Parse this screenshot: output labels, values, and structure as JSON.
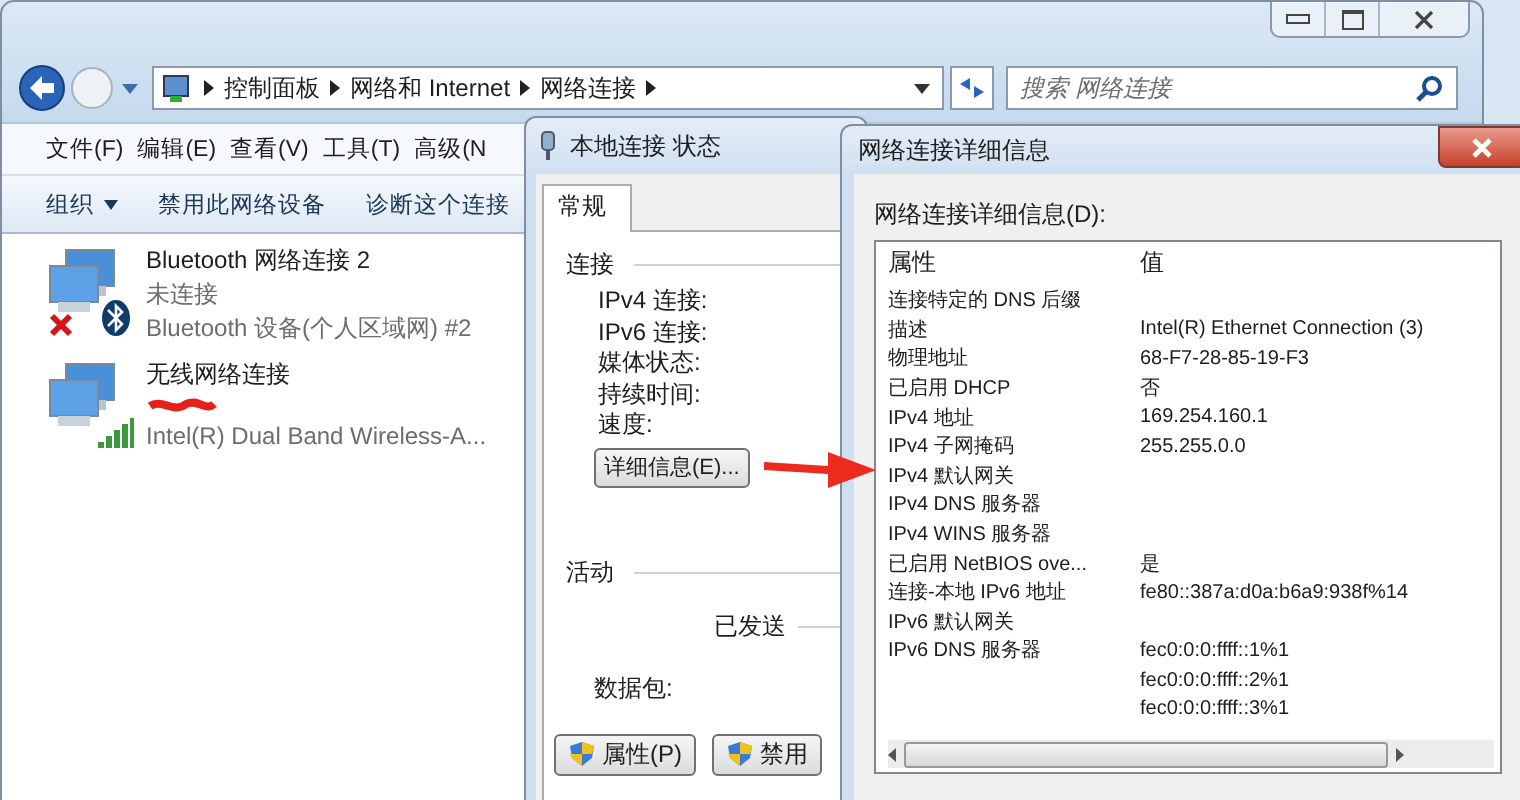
{
  "explorer": {
    "breadcrumb": [
      "控制面板",
      "网络和 Internet",
      "网络连接"
    ],
    "search": {
      "placeholder": "搜索 网络连接"
    },
    "menu": [
      "文件(F)",
      "编辑(E)",
      "查看(V)",
      "工具(T)",
      "高级(N"
    ],
    "toolbar": [
      {
        "label": "组织",
        "dropdown": true
      },
      {
        "label": "禁用此网络设备",
        "dropdown": false
      },
      {
        "label": "诊断这个连接",
        "dropdown": false
      }
    ],
    "connections": [
      {
        "kind": "bluetooth",
        "name": "Bluetooth 网络连接 2",
        "status": "未连接",
        "device": "Bluetooth 设备(个人区域网) #2",
        "disconnected": true,
        "redacted": false
      },
      {
        "kind": "wireless",
        "name": "无线网络连接",
        "device": "Intel(R) Dual Band Wireless-A...",
        "disconnected": false,
        "redacted": true
      }
    ]
  },
  "status_dialog": {
    "title": "本地连接 状态",
    "tabs": [
      {
        "label": "常规",
        "selected": true
      }
    ],
    "connection_heading": "连接",
    "fields": [
      "IPv4 连接:",
      "IPv6 连接:",
      "媒体状态:",
      "持续时间:",
      "速度:"
    ],
    "details_button": "详细信息(E)...",
    "activity_heading": "活动",
    "sent": "已发送",
    "packets": "数据包:",
    "buttons": [
      {
        "label": "属性(P)",
        "shield": true
      },
      {
        "label": "禁用",
        "shield": true
      }
    ]
  },
  "details_dialog": {
    "title": "网络连接详细信息",
    "list_label": "网络连接详细信息(D):",
    "columns": [
      "属性",
      "值"
    ],
    "rows": [
      {
        "property": "连接特定的 DNS 后缀"
      },
      {
        "property": "描述",
        "value": "Intel(R) Ethernet Connection (3)"
      },
      {
        "property": "物理地址",
        "value": "68-F7-28-85-19-F3"
      },
      {
        "property": "已启用 DHCP",
        "value": "否"
      },
      {
        "property": "IPv4 地址",
        "value": "169.254.160.1"
      },
      {
        "property": "IPv4 子网掩码",
        "value": "255.255.0.0"
      },
      {
        "property": "IPv4 默认网关"
      },
      {
        "property": "IPv4 DNS 服务器"
      },
      {
        "property": "IPv4 WINS 服务器"
      },
      {
        "property": "已启用 NetBIOS ove...",
        "value": "是"
      },
      {
        "property": "连接-本地 IPv6 地址",
        "value": "fe80::387a:d0a:b6a9:938f%14"
      },
      {
        "property": "IPv6 默认网关"
      },
      {
        "property": "IPv6 DNS 服务器",
        "value": "fec0:0:0:ffff::1%1"
      },
      {
        "value": "fec0:0:0:ffff::2%1"
      },
      {
        "value": "fec0:0:0:ffff::3%1"
      }
    ]
  }
}
